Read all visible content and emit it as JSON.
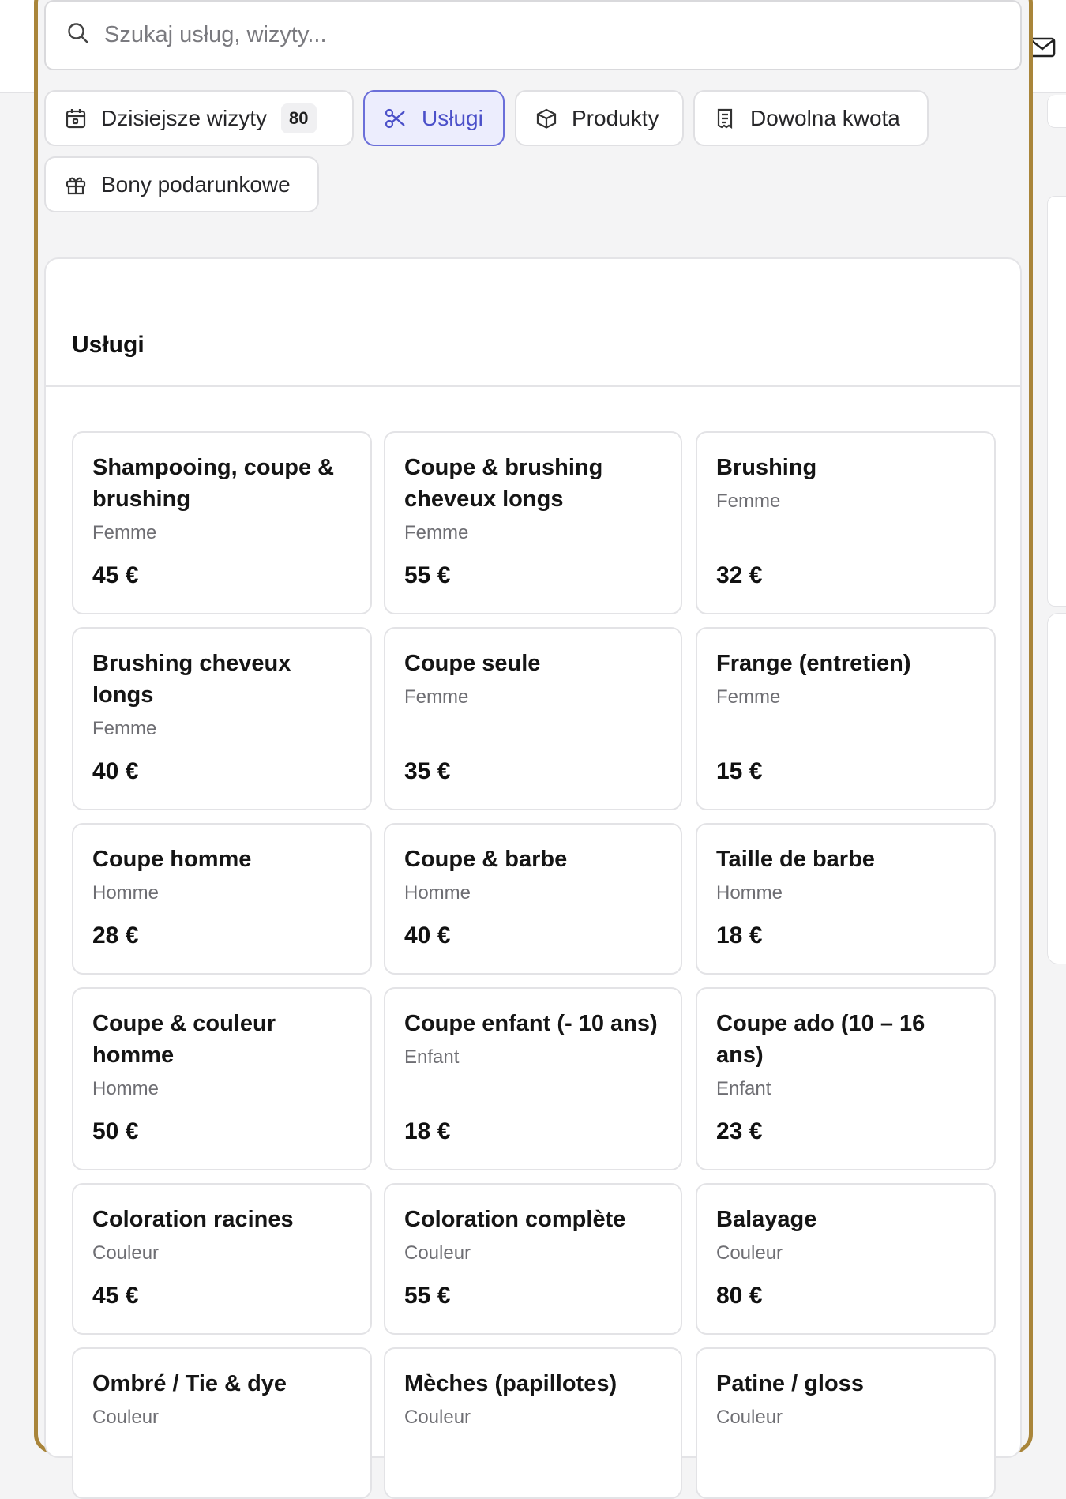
{
  "search": {
    "placeholder": "Szukaj usług, wizyty..."
  },
  "tabs": [
    {
      "label": "Dzisiejsze wizyty",
      "badge": "80"
    },
    {
      "label": "Usługi"
    },
    {
      "label": "Produkty"
    },
    {
      "label": "Dowolna kwota"
    },
    {
      "label": "Bony podarunkowe"
    }
  ],
  "panel": {
    "title": "Usługi"
  },
  "services": [
    {
      "name": "Shampooing, coupe & brushing",
      "category": "Femme",
      "price": "45 €"
    },
    {
      "name": "Coupe & brushing cheveux longs",
      "category": "Femme",
      "price": "55 €"
    },
    {
      "name": "Brushing",
      "category": "Femme",
      "price": "32 €"
    },
    {
      "name": "Brushing cheveux longs",
      "category": "Femme",
      "price": "40 €"
    },
    {
      "name": "Coupe seule",
      "category": "Femme",
      "price": "35 €"
    },
    {
      "name": "Frange (entretien)",
      "category": "Femme",
      "price": "15 €"
    },
    {
      "name": "Coupe homme",
      "category": "Homme",
      "price": "28 €"
    },
    {
      "name": "Coupe & barbe",
      "category": "Homme",
      "price": "40 €"
    },
    {
      "name": "Taille de barbe",
      "category": "Homme",
      "price": "18 €"
    },
    {
      "name": "Coupe & couleur homme",
      "category": "Homme",
      "price": "50 €"
    },
    {
      "name": "Coupe enfant (- 10 ans)",
      "category": "Enfant",
      "price": "18 €"
    },
    {
      "name": "Coupe ado (10 – 16 ans)",
      "category": "Enfant",
      "price": "23 €"
    },
    {
      "name": "Coloration racines",
      "category": "Couleur",
      "price": "45 €"
    },
    {
      "name": "Coloration complète",
      "category": "Couleur",
      "price": "55 €"
    },
    {
      "name": "Balayage",
      "category": "Couleur",
      "price": "80 €"
    },
    {
      "name": "Ombré / Tie & dye",
      "category": "Couleur",
      "price": ""
    },
    {
      "name": "Mèches (papillotes)",
      "category": "Couleur",
      "price": ""
    },
    {
      "name": "Patine / gloss",
      "category": "Couleur",
      "price": ""
    }
  ]
}
